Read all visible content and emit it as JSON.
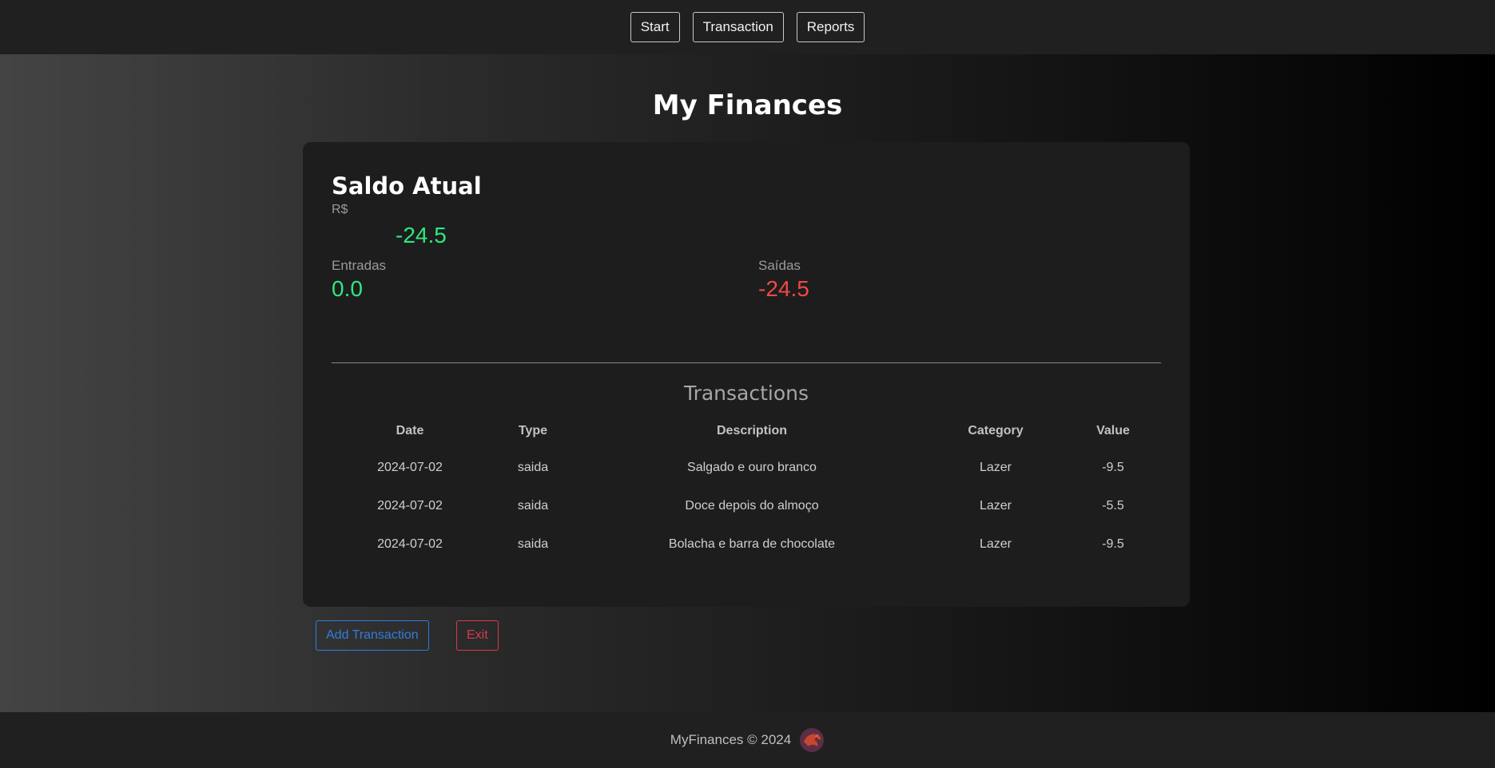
{
  "nav": {
    "items": [
      {
        "label": "Start"
      },
      {
        "label": "Transaction"
      },
      {
        "label": "Reports"
      }
    ]
  },
  "page": {
    "title": "My Finances"
  },
  "balance": {
    "title": "Saldo Atual",
    "currency": "R$",
    "value": "-24.5",
    "income_label": "Entradas",
    "income_value": "0.0",
    "expense_label": "Saídas",
    "expense_value": "-24.5"
  },
  "transactions": {
    "title": "Transactions",
    "columns": [
      "Date",
      "Type",
      "Description",
      "Category",
      "Value"
    ],
    "rows": [
      [
        "2024-07-02",
        "saida",
        "Salgado e ouro branco",
        "Lazer",
        "-9.5"
      ],
      [
        "2024-07-02",
        "saida",
        "Doce depois do almoço",
        "Lazer",
        "-5.5"
      ],
      [
        "2024-07-02",
        "saida",
        "Bolacha e barra de chocolate",
        "Lazer",
        "-9.5"
      ]
    ]
  },
  "actions": {
    "add_label": "Add Transaction",
    "exit_label": "Exit"
  },
  "footer": {
    "text": "MyFinances © 2024",
    "logo_icon": "dragon-logo-icon"
  },
  "colors": {
    "positive": "#2ee87f",
    "negative": "#f04848",
    "primary": "#2f7ddf",
    "danger": "#d63a4a"
  }
}
